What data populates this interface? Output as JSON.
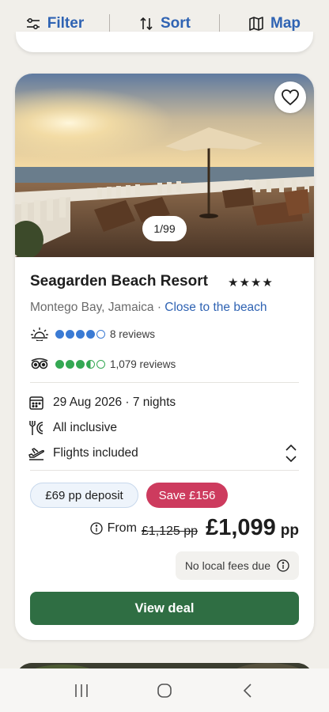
{
  "toolbar": {
    "filter_label": "Filter",
    "sort_label": "Sort",
    "map_label": "Map",
    "accent": "#2f63b3"
  },
  "listing": {
    "title": "Seagarden Beach Resort",
    "stars": "★★★★",
    "star_rating": 4,
    "location": "Montego Bay, Jamaica · ",
    "location_tag": "Close to the beach",
    "image_counter": "1/99",
    "favorite_icon": "heart-outline-icon",
    "traveller_rating": {
      "icon": "sun-icon",
      "score": 4,
      "out_of": 5,
      "color": "#3b7bd4",
      "reviews_text": "8 reviews"
    },
    "tripadvisor_rating": {
      "icon": "tripadvisor-owl-icon",
      "score": 3.5,
      "out_of": 5,
      "color": "#34a853",
      "reviews_text": "1,079 reviews"
    },
    "dates": "29 Aug 2026 · 7 nights",
    "board": "All inclusive",
    "flights": "Flights included",
    "deposit_chip": "£69 pp deposit",
    "save_chip": "Save £156",
    "save_color": "#cd3b5e",
    "from_label": "From",
    "old_price": "£1,125 pp",
    "price": "£1,099",
    "price_unit": "pp",
    "fees_note": "No local fees due",
    "cta_label": "View deal",
    "cta_color": "#2f6e43"
  },
  "system_nav": {
    "recents_icon": "recents-icon",
    "home_icon": "home-icon",
    "back_icon": "back-icon"
  }
}
